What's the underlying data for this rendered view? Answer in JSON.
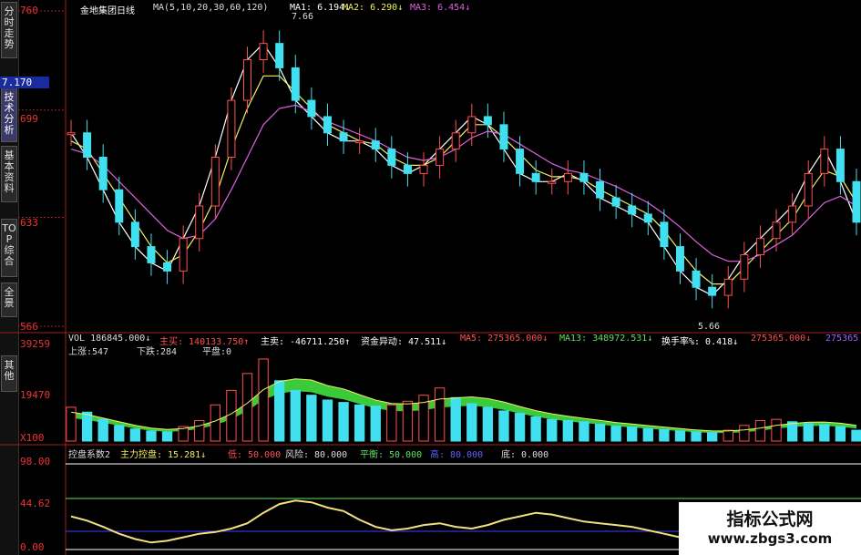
{
  "sidebar": {
    "tabs": [
      {
        "label": "分时走势",
        "active": false
      },
      {
        "label": "技术分析",
        "active": true
      },
      {
        "label": "基本资料",
        "active": false
      },
      {
        "label": "TOP综合",
        "active": false
      },
      {
        "label": "全景",
        "active": false
      },
      {
        "label": "其他",
        "active": false
      }
    ]
  },
  "price_panel": {
    "title": "金地集团日线",
    "ma_line": "MA(5,10,20,30,60,120)",
    "ma1": "MA1: 6.194↓",
    "ma2": "MA2: 6.290↓",
    "ma3": "MA3: 6.454↓",
    "y_ticks": [
      "760",
      "699",
      "633",
      "566"
    ],
    "current_price_label": "7.170",
    "high_marker": "7.66",
    "low_marker": "5.66"
  },
  "volume_panel": {
    "vol": "VOL 186845.000↓",
    "buy": "主买: 140133.750↑",
    "sell": "主卖: -46711.250↑",
    "fund": "资金异动: 47.511↓",
    "ma5": "MA5: 275365.000↓",
    "ma13": "MA13: 348972.531↓",
    "turnover": "换手率%: 0.418↓",
    "ma5b": "275365.000↓",
    "ma5c": "275365",
    "up": "上涨:547",
    "down": "下跌:284",
    "flat": "平盘:0",
    "y_ticks": [
      "39259",
      "19470",
      "X100"
    ]
  },
  "indicator_panel": {
    "name": "控盘系数2",
    "main": "主力控盘: 15.281↓",
    "low": "低: 50.000",
    "risk": "风险: 80.000",
    "balance": "平衡: 50.000",
    "high": "高: 80.000",
    "bottom": "底: 0.000",
    "y_ticks": [
      "98.00",
      "44.62",
      "0.00"
    ]
  },
  "watermark": {
    "title": "指标公式网",
    "url": "www.zbgs3.com"
  },
  "colors": {
    "up": "#ff5050",
    "down": "#40e0f0",
    "ma_white": "#ffffff",
    "ma_yellow": "#f0f060",
    "ma_magenta": "#e060e0",
    "ma_green": "#60e060",
    "ma_blue": "#4040ff",
    "volume_band": "#40e040"
  },
  "chart_data": [
    {
      "type": "line",
      "title": "金地集团日线",
      "ylabel": "",
      "yticks": [
        5.66,
        6.33,
        6.99,
        7.6
      ],
      "ylim": [
        5.66,
        7.6
      ],
      "x": [
        1,
        2,
        3,
        4,
        5,
        6,
        7,
        8,
        9,
        10,
        11,
        12,
        13,
        14,
        15,
        16,
        17,
        18,
        19,
        20,
        21,
        22,
        23,
        24,
        25,
        26,
        27,
        28,
        29,
        30,
        31,
        32,
        33,
        34,
        35,
        36,
        37,
        38,
        39,
        40,
        41,
        42,
        43,
        44,
        45,
        46,
        47,
        48,
        49,
        50
      ],
      "series": [
        {
          "name": "MA1",
          "values": [
            6.85,
            6.7,
            6.5,
            6.3,
            6.15,
            6.05,
            6.0,
            6.2,
            6.4,
            6.7,
            7.05,
            7.3,
            7.4,
            7.25,
            7.05,
            6.95,
            6.85,
            6.8,
            6.8,
            6.75,
            6.65,
            6.6,
            6.65,
            6.75,
            6.85,
            6.95,
            6.9,
            6.75,
            6.6,
            6.55,
            6.55,
            6.6,
            6.55,
            6.45,
            6.4,
            6.35,
            6.3,
            6.15,
            6.0,
            5.9,
            5.85,
            5.95,
            6.1,
            6.2,
            6.3,
            6.4,
            6.6,
            6.75,
            6.55,
            6.3
          ]
        },
        {
          "name": "MA2",
          "values": [
            6.8,
            6.75,
            6.6,
            6.45,
            6.3,
            6.15,
            6.05,
            6.1,
            6.25,
            6.45,
            6.75,
            7.0,
            7.2,
            7.2,
            7.1,
            7.0,
            6.9,
            6.85,
            6.8,
            6.78,
            6.7,
            6.65,
            6.65,
            6.7,
            6.8,
            6.9,
            6.9,
            6.82,
            6.72,
            6.62,
            6.58,
            6.58,
            6.56,
            6.5,
            6.45,
            6.4,
            6.35,
            6.25,
            6.12,
            6.0,
            5.92,
            5.92,
            6.02,
            6.12,
            6.22,
            6.32,
            6.48,
            6.62,
            6.58,
            6.42
          ]
        },
        {
          "name": "MA3",
          "values": [
            6.75,
            6.72,
            6.65,
            6.55,
            6.45,
            6.35,
            6.25,
            6.2,
            6.22,
            6.32,
            6.5,
            6.7,
            6.9,
            7.0,
            7.02,
            6.98,
            6.92,
            6.88,
            6.84,
            6.8,
            6.75,
            6.7,
            6.68,
            6.7,
            6.75,
            6.82,
            6.86,
            6.84,
            6.78,
            6.72,
            6.66,
            6.62,
            6.6,
            6.56,
            6.52,
            6.47,
            6.42,
            6.35,
            6.27,
            6.18,
            6.1,
            6.06,
            6.06,
            6.1,
            6.16,
            6.22,
            6.32,
            6.42,
            6.46,
            6.4
          ]
        }
      ]
    },
    {
      "type": "bar",
      "title": "VOL",
      "ylim": [
        0,
        39259
      ],
      "yticks": [
        19470,
        39259
      ],
      "categories": [
        1,
        2,
        3,
        4,
        5,
        6,
        7,
        8,
        9,
        10,
        11,
        12,
        13,
        14,
        15,
        16,
        17,
        18,
        19,
        20,
        21,
        22,
        23,
        24,
        25,
        26,
        27,
        28,
        29,
        30,
        31,
        32,
        33,
        34,
        35,
        36,
        37,
        38,
        39,
        40,
        41,
        42,
        43,
        44,
        45,
        46,
        47,
        48,
        49,
        50
      ],
      "values": [
        14000,
        12000,
        9000,
        6500,
        5000,
        4200,
        3800,
        6000,
        8500,
        15000,
        21000,
        28000,
        34000,
        25000,
        21000,
        19000,
        17000,
        16000,
        15000,
        14500,
        15000,
        16500,
        19000,
        22000,
        18000,
        15500,
        14000,
        12500,
        11500,
        10000,
        9000,
        8500,
        8000,
        7000,
        6200,
        5800,
        5200,
        4800,
        4200,
        3800,
        3500,
        4500,
        6500,
        8500,
        9000,
        8000,
        7200,
        6800,
        6000,
        4500
      ],
      "series": [
        {
          "name": "MA5",
          "values": [
            12000,
            11000,
            9500,
            8000,
            6500,
            5400,
            4800,
            5200,
            6300,
            8300,
            11300,
            15700,
            21300,
            24700,
            25800,
            25300,
            23000,
            21600,
            19200,
            17000,
            15600,
            15400,
            16000,
            17400,
            17900,
            18300,
            17600,
            16200,
            14300,
            12600,
            11300,
            10300,
            9400,
            8600,
            7700,
            7100,
            6400,
            5800,
            5200,
            4600,
            4200,
            4200,
            4600,
            5400,
            6500,
            7300,
            7800,
            7900,
            7400,
            6500
          ]
        }
      ]
    },
    {
      "type": "line",
      "title": "控盘系数2",
      "ylim": [
        0,
        98
      ],
      "yticks": [
        0,
        44.62,
        98
      ],
      "x": [
        1,
        2,
        3,
        4,
        5,
        6,
        7,
        8,
        9,
        10,
        11,
        12,
        13,
        14,
        15,
        16,
        17,
        18,
        19,
        20,
        21,
        22,
        23,
        24,
        25,
        26,
        27,
        28,
        29,
        30,
        31,
        32,
        33,
        34,
        35,
        36,
        37,
        38,
        39,
        40,
        41,
        42,
        43,
        44,
        45,
        46,
        47,
        48,
        49,
        50
      ],
      "series": [
        {
          "name": "主力控盘",
          "values": [
            38,
            33,
            26,
            18,
            12,
            8,
            10,
            14,
            18,
            20,
            24,
            30,
            42,
            52,
            56,
            54,
            48,
            44,
            34,
            26,
            22,
            24,
            28,
            30,
            26,
            24,
            28,
            34,
            38,
            42,
            40,
            36,
            32,
            30,
            28,
            26,
            22,
            18,
            14,
            10,
            6,
            5,
            4,
            5,
            6,
            8,
            12,
            16,
            18,
            15
          ]
        }
      ]
    }
  ]
}
